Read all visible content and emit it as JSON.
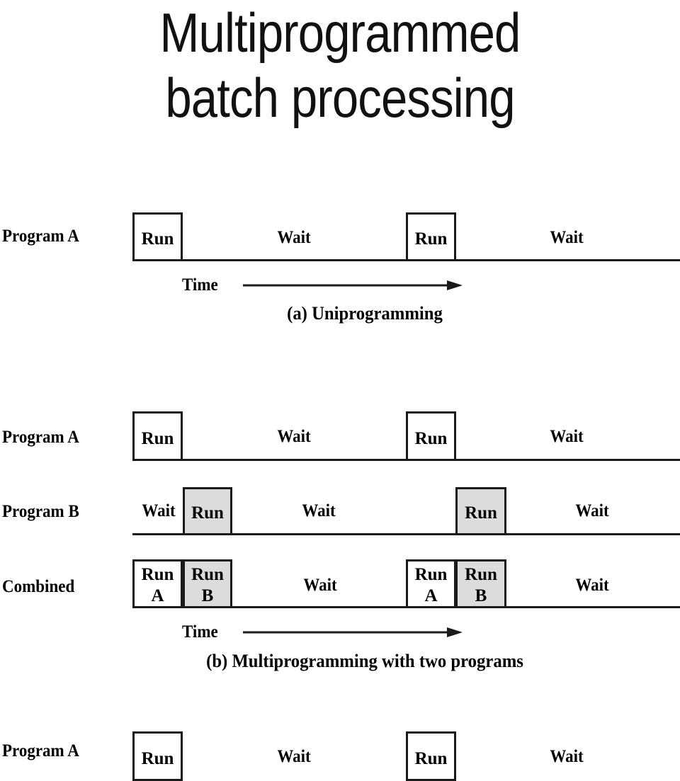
{
  "title": {
    "line1": "Multiprogrammed",
    "line2": "batch processing"
  },
  "colors": {
    "line": "#1a1a1a",
    "shaded_box_fill": "#dcdcdc",
    "plain_box_fill": "#ffffff",
    "text": "#000000"
  },
  "labels": {
    "run": "Run",
    "wait": "Wait",
    "time": "Time",
    "program_a": "Program A",
    "program_b": "Program B",
    "combined": "Combined",
    "run_a_top": "Run",
    "run_a_bottom": "A",
    "run_b_top": "Run",
    "run_b_bottom": "B"
  },
  "diagram_a": {
    "caption": "(a) Uniprogramming",
    "time_label": "Time",
    "rows": [
      {
        "label": "Program A",
        "segments": [
          {
            "kind": "run",
            "text": "Run",
            "shaded": false
          },
          {
            "kind": "wait",
            "text": "Wait"
          },
          {
            "kind": "run",
            "text": "Run",
            "shaded": false
          },
          {
            "kind": "wait",
            "text": "Wait"
          }
        ]
      }
    ]
  },
  "diagram_b": {
    "caption": "(b) Multiprogramming with two programs",
    "time_label": "Time",
    "rows": [
      {
        "label": "Program A",
        "segments": [
          {
            "kind": "run",
            "text": "Run",
            "shaded": false
          },
          {
            "kind": "wait",
            "text": "Wait"
          },
          {
            "kind": "run",
            "text": "Run",
            "shaded": false
          },
          {
            "kind": "wait",
            "text": "Wait"
          }
        ]
      },
      {
        "label": "Program B",
        "segments": [
          {
            "kind": "wait",
            "text": "Wait"
          },
          {
            "kind": "run",
            "text": "Run",
            "shaded": true
          },
          {
            "kind": "wait",
            "text": "Wait"
          },
          {
            "kind": "run",
            "text": "Run",
            "shaded": true
          },
          {
            "kind": "wait",
            "text": "Wait"
          }
        ]
      },
      {
        "label": "Combined",
        "segments": [
          {
            "kind": "run",
            "text": "Run",
            "sub": "A",
            "shaded": false
          },
          {
            "kind": "run",
            "text": "Run",
            "sub": "B",
            "shaded": true
          },
          {
            "kind": "wait",
            "text": "Wait"
          },
          {
            "kind": "run",
            "text": "Run",
            "sub": "A",
            "shaded": false
          },
          {
            "kind": "run",
            "text": "Run",
            "sub": "B",
            "shaded": true
          },
          {
            "kind": "wait",
            "text": "Wait"
          }
        ]
      }
    ]
  },
  "diagram_c_partial": {
    "rows": [
      {
        "label": "Program A",
        "segments": [
          {
            "kind": "run",
            "text": "Run",
            "shaded": false
          },
          {
            "kind": "wait",
            "text": "Wait"
          },
          {
            "kind": "run",
            "text": "Run",
            "shaded": false
          },
          {
            "kind": "wait",
            "text": "Wait"
          }
        ]
      }
    ]
  }
}
